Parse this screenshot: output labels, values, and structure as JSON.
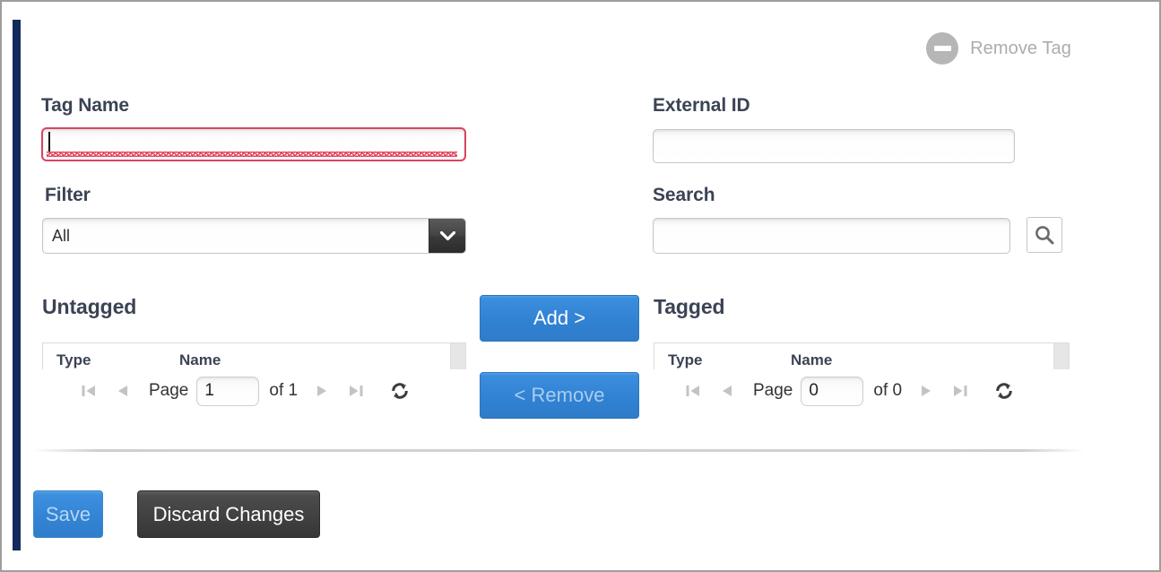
{
  "header": {
    "remove_tag_label": "Remove Tag",
    "remove_tag_icon": "minus-circle-icon"
  },
  "form": {
    "tag_name": {
      "label": "Tag Name",
      "value": "",
      "placeholder": "",
      "invalid": true
    },
    "external_id": {
      "label": "External ID",
      "value": "",
      "placeholder": ""
    },
    "filter": {
      "label": "Filter",
      "selected": "All",
      "icon": "chevron-down-icon"
    },
    "search": {
      "label": "Search",
      "value": "",
      "placeholder": "",
      "button_icon": "search-icon"
    }
  },
  "untagged": {
    "title": "Untagged",
    "columns": [
      "Type",
      "Name"
    ],
    "rows": [],
    "pager": {
      "page_label": "Page",
      "page_value": "1",
      "of_label": "of 1",
      "first_icon": "first-page-icon",
      "prev_icon": "prev-page-icon",
      "next_icon": "next-page-icon",
      "last_icon": "last-page-icon",
      "refresh_icon": "refresh-icon"
    }
  },
  "tagged": {
    "title": "Tagged",
    "columns": [
      "Type",
      "Name"
    ],
    "rows": [],
    "pager": {
      "page_label": "Page",
      "page_value": "0",
      "of_label": "of 0",
      "first_icon": "first-page-icon",
      "prev_icon": "prev-page-icon",
      "next_icon": "next-page-icon",
      "last_icon": "last-page-icon",
      "refresh_icon": "refresh-icon"
    }
  },
  "transfer": {
    "add_label": "Add >",
    "remove_label": "< Remove"
  },
  "footer": {
    "save_label": "Save",
    "discard_label": "Discard Changes"
  },
  "colors": {
    "accent_bar": "#122b5e",
    "primary_button": "#3182d3",
    "dark_button": "#414141",
    "invalid_border": "#d9455f",
    "label_text": "#3b4354",
    "disabled_text": "#acacac"
  }
}
